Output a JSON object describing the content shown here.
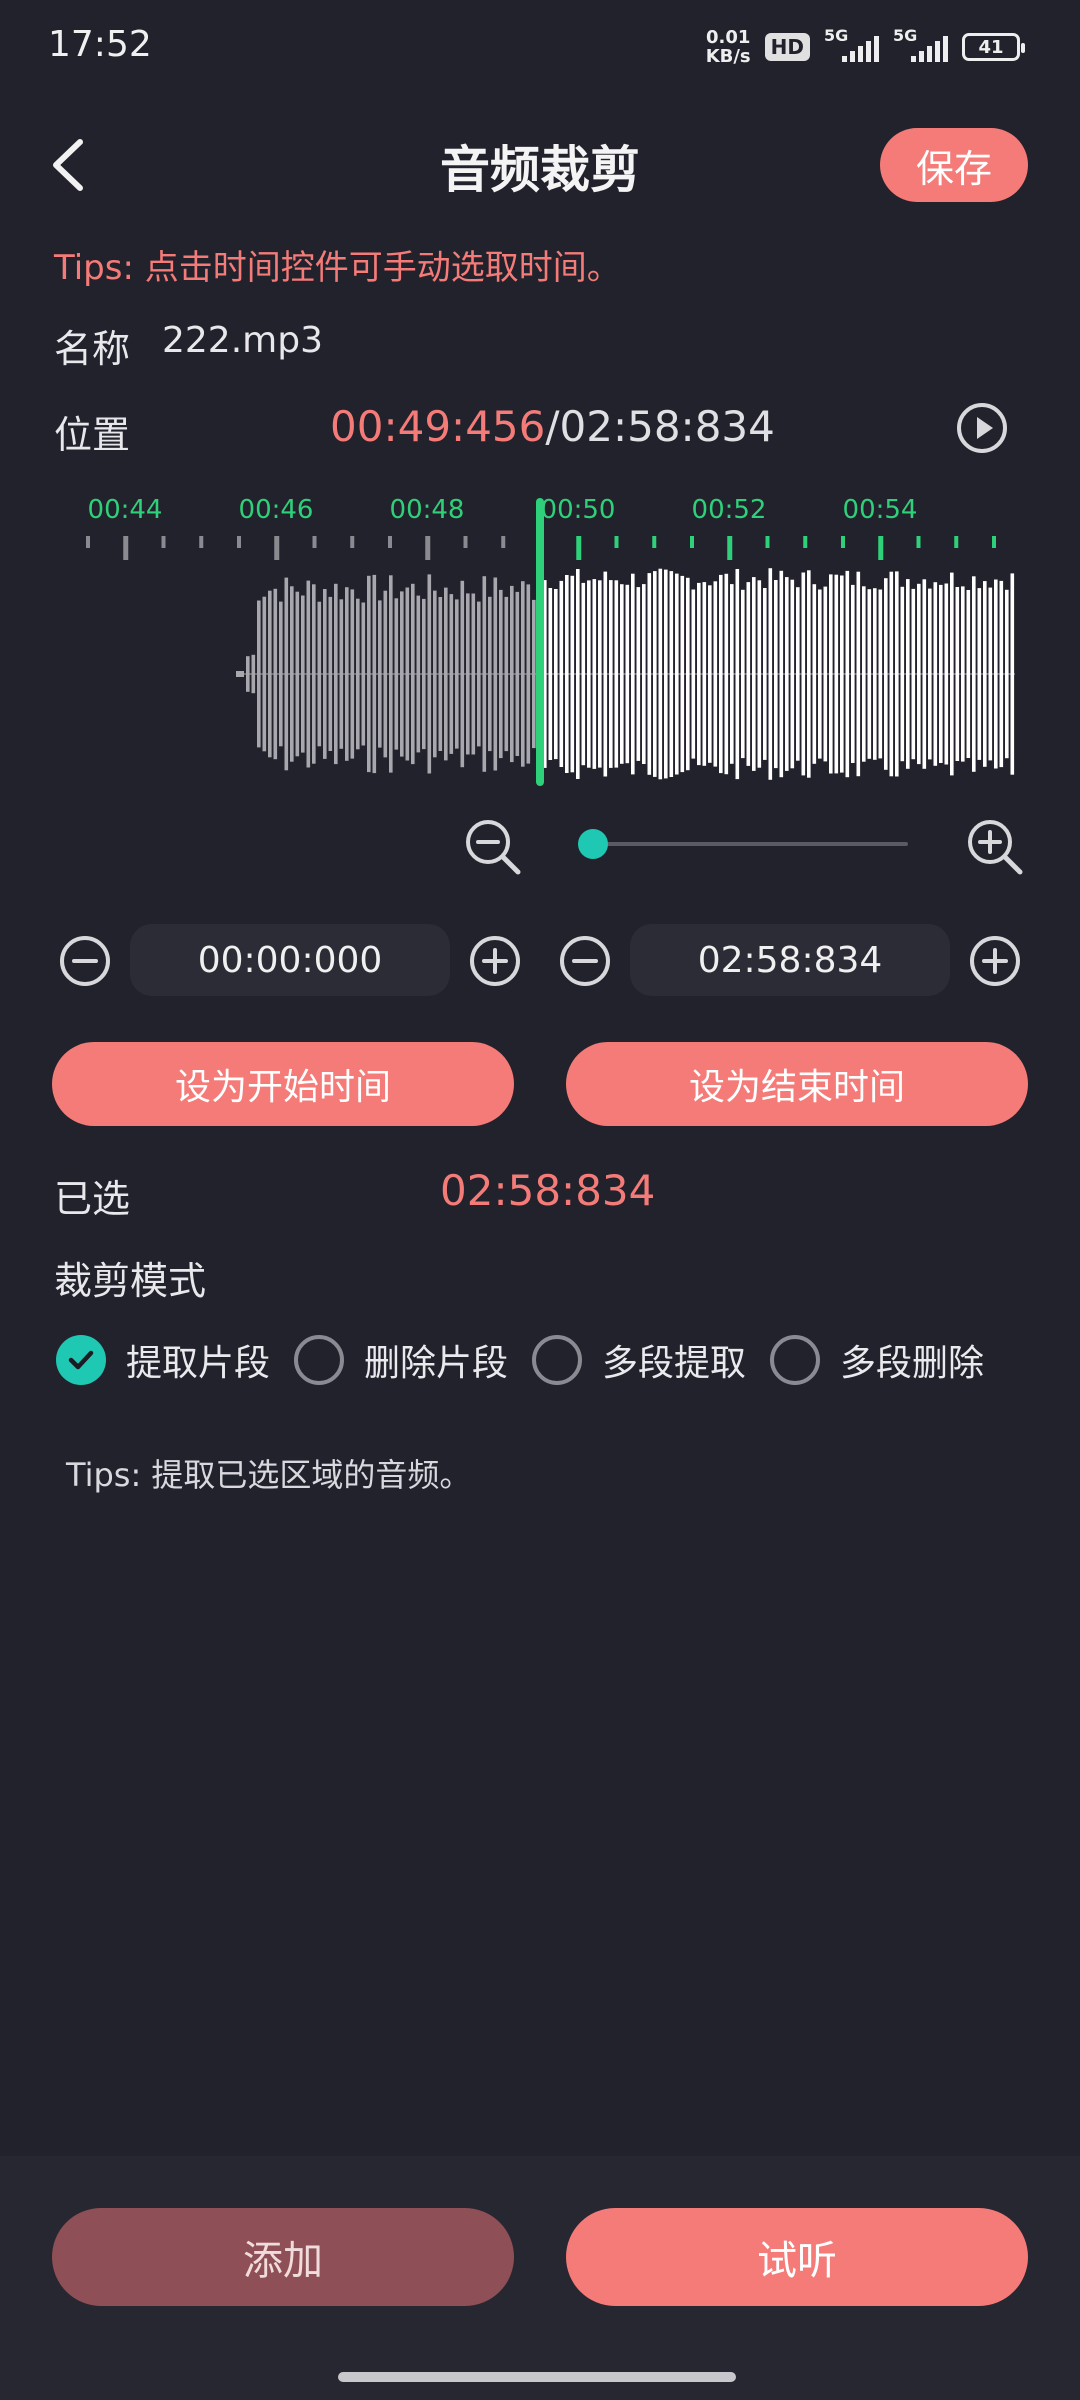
{
  "status_bar": {
    "time": "17:52",
    "net_speed_value": "0.01",
    "net_speed_unit": "KB/s",
    "hd_badge": "HD",
    "signal1_label": "5G",
    "signal2_label": "5G",
    "battery": "41"
  },
  "header": {
    "title": "音频裁剪",
    "save_label": "保存"
  },
  "tips_top": "Tips: 点击时间控件可手动选取时间。",
  "name": {
    "label": "名称",
    "value": "222.mp3"
  },
  "position": {
    "label": "位置",
    "current": "00:49:456",
    "separator": "/",
    "total": "02:58:834"
  },
  "waveform": {
    "tick_labels": [
      "00:44",
      "00:46",
      "00:48",
      "00:50",
      "00:52",
      "00:54"
    ],
    "played_color": "#a7a7ad",
    "unplayed_color": "#ffffff",
    "cursor_color": "#2fd07a"
  },
  "zoom": {
    "level": 0.0
  },
  "start_time": {
    "value": "00:00:000"
  },
  "end_time": {
    "value": "02:58:834"
  },
  "buttons": {
    "set_start": "设为开始时间",
    "set_end": "设为结束时间",
    "add": "添加",
    "listen": "试听"
  },
  "selected": {
    "label": "已选",
    "value": "02:58:834"
  },
  "mode": {
    "label": "裁剪模式",
    "options": [
      {
        "label": "提取片段",
        "checked": true
      },
      {
        "label": "删除片段",
        "checked": false
      },
      {
        "label": "多段提取",
        "checked": false
      },
      {
        "label": "多段删除",
        "checked": false
      }
    ]
  },
  "tips_mode": "Tips: 提取已选区域的音频。",
  "colors": {
    "accent": "#f47b78",
    "teal": "#1fc8b3",
    "background": "#22222c"
  }
}
